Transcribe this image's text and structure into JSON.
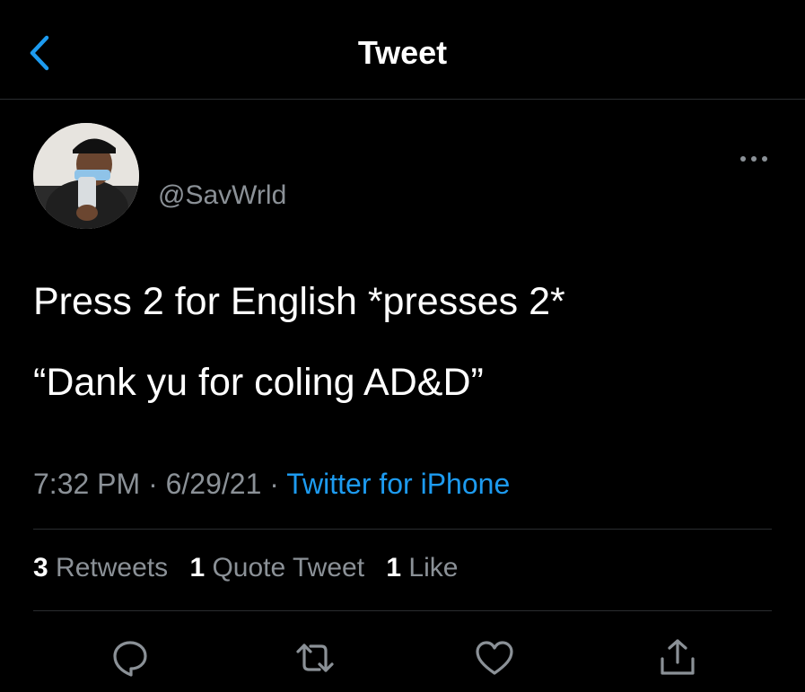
{
  "header": {
    "title": "Tweet",
    "back_icon": "chevron-left-icon"
  },
  "colors": {
    "background": "#000000",
    "accent": "#1d9bf0",
    "secondary_text": "#8b9197",
    "primary_text": "#ffffff"
  },
  "tweet": {
    "handle": "@SavWrld",
    "text_line1": "Press 2 for English *presses 2*",
    "text_line2": "“Dank yu for coling AD&D”",
    "time": "7:32 PM",
    "date": "6/29/21",
    "separator": "·",
    "source": "Twitter for iPhone"
  },
  "stats": {
    "retweets_count": "3",
    "retweets_label": "Retweets",
    "quotes_count": "1",
    "quotes_label": "Quote Tweet",
    "likes_count": "1",
    "likes_label": "Like"
  },
  "actions": [
    "reply-icon",
    "retweet-icon",
    "like-icon",
    "share-icon"
  ]
}
